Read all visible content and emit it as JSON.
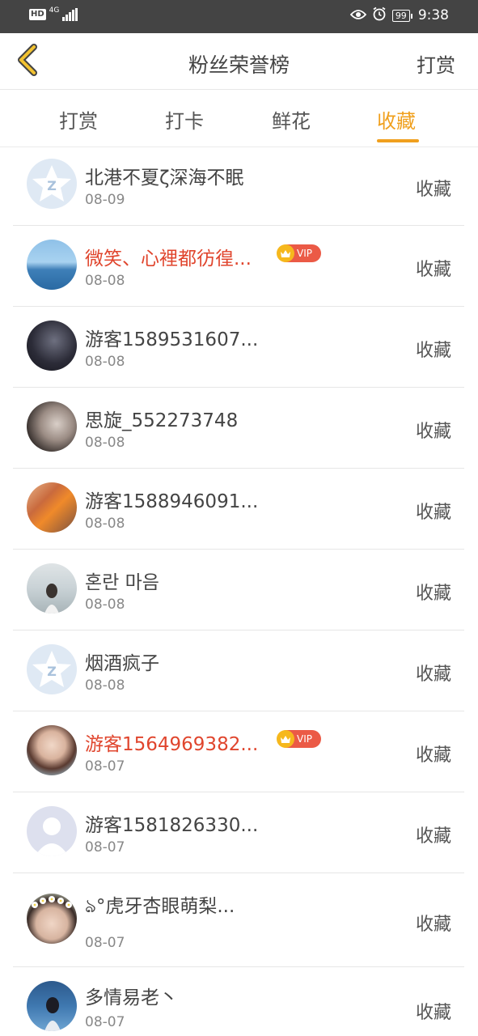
{
  "status_bar": {
    "hd": "HD",
    "network": "4G",
    "battery": "99",
    "time": "9:38"
  },
  "header": {
    "title": "粉丝荣誉榜",
    "action": "打赏",
    "back_icon": "chevron-left-icon"
  },
  "tabs": [
    {
      "label": "打赏",
      "active": false
    },
    {
      "label": "打卡",
      "active": false
    },
    {
      "label": "鲜花",
      "active": false
    },
    {
      "label": "收藏",
      "active": true
    }
  ],
  "colors": {
    "accent": "#f0a01e",
    "vip_name": "#e0452d",
    "status_bar": "#444444"
  },
  "rows": [
    {
      "name": "北港不夏ζ深海不眠",
      "date": "08-09",
      "action": "收藏",
      "vip": false,
      "avatar": "default-qq-avatar"
    },
    {
      "name": "微笑、心裡都彷徨...",
      "date": "08-08",
      "action": "收藏",
      "vip": true,
      "vip_label": "VIP",
      "avatar": "sea-photo-avatar"
    },
    {
      "name": "游客1589531607...",
      "date": "08-08",
      "action": "收藏",
      "vip": false,
      "avatar": "dark-photo-avatar"
    },
    {
      "name": "思旋_552273748",
      "date": "08-08",
      "action": "收藏",
      "vip": false,
      "avatar": "portrait-avatar"
    },
    {
      "name": "游客1588946091...",
      "date": "08-08",
      "action": "收藏",
      "vip": false,
      "avatar": "group-photo-avatar"
    },
    {
      "name": "혼란 마음",
      "date": "08-08",
      "action": "收藏",
      "vip": false,
      "avatar": "beach-girl-avatar"
    },
    {
      "name": "烟酒疯子",
      "date": "08-08",
      "action": "收藏",
      "vip": false,
      "avatar": "default-qq-avatar"
    },
    {
      "name": "游客1564969382...",
      "date": "08-07",
      "action": "收藏",
      "vip": true,
      "vip_label": "VIP",
      "avatar": "girl-photo-avatar"
    },
    {
      "name": "游客1581826330...",
      "date": "08-07",
      "action": "收藏",
      "vip": false,
      "avatar": "default-person-avatar"
    },
    {
      "name": "ঌ°虎牙杏眼萌梨...",
      "date": "08-07",
      "action": "收藏",
      "vip": false,
      "avatar": "flower-crown-avatar"
    },
    {
      "name": "多情易老丶",
      "date": "08-07",
      "action": "收藏",
      "vip": false,
      "avatar": "blue-photo-avatar"
    }
  ]
}
